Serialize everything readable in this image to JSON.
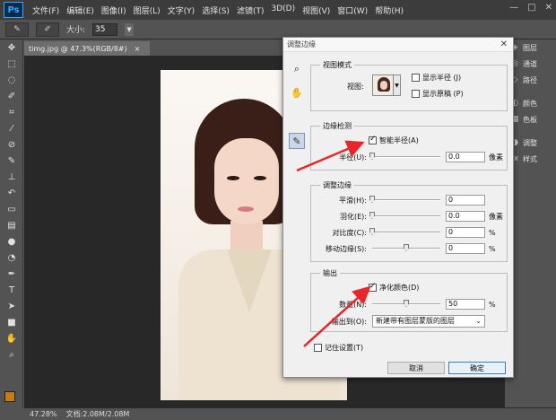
{
  "app": {
    "logo": "Ps",
    "menu": [
      "文件(F)",
      "编辑(E)",
      "图像(I)",
      "图层(L)",
      "文字(Y)",
      "选择(S)",
      "滤镜(T)",
      "3D(D)",
      "视图(V)",
      "窗口(W)",
      "帮助(H)"
    ],
    "window_controls": [
      "—",
      "□",
      "✕"
    ]
  },
  "options": {
    "size_label": "大小:",
    "size_value": "35"
  },
  "document": {
    "tab_title": "timg.jpg @ 47.3%(RGB/8#)",
    "tab_close": "×",
    "zoom": "47.28%",
    "doc_info": "文档:2.08M/2.08M"
  },
  "right_panel": {
    "items": [
      "图层",
      "通道",
      "路径",
      "颜色",
      "色板",
      "调整",
      "样式"
    ]
  },
  "dialog": {
    "title": "调整边缘",
    "close": "✕",
    "view_mode": {
      "title": "视图模式",
      "view_label": "视图:",
      "show_radius": "显示半径 (J)",
      "show_original": "显示原稿 (P)"
    },
    "edge_detection": {
      "title": "边缘检测",
      "smart_radius": "智能半径(A)",
      "radius_label": "半径(U):",
      "radius_value": "0.0",
      "radius_unit": "像素"
    },
    "adjust_edge": {
      "title": "调整边缘",
      "smooth_label": "平滑(H):",
      "smooth_value": "0",
      "feather_label": "羽化(E):",
      "feather_value": "0.0",
      "feather_unit": "像素",
      "contrast_label": "对比度(C):",
      "contrast_value": "0",
      "contrast_unit": "%",
      "shift_label": "移动边缘(S):",
      "shift_value": "0",
      "shift_unit": "%"
    },
    "output": {
      "title": "输出",
      "decontaminate": "净化颜色(D)",
      "amount_label": "数量(N):",
      "amount_value": "50",
      "amount_unit": "%",
      "output_to_label": "输出到(O):",
      "output_to_value": "新建带有图层蒙版的图层"
    },
    "remember": "记住设置(T)",
    "cancel": "取消",
    "ok": "确定"
  },
  "colors": {
    "foreground": "#c77a18",
    "background": "#f4f4f4",
    "annotation_arrow": "#e8262a"
  }
}
